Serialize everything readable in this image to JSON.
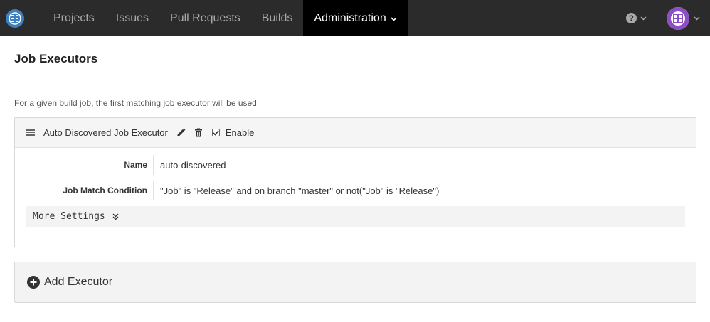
{
  "nav": {
    "items": [
      {
        "label": "Projects"
      },
      {
        "label": "Issues"
      },
      {
        "label": "Pull Requests"
      },
      {
        "label": "Builds"
      },
      {
        "label": "Administration"
      }
    ],
    "active_index": 4
  },
  "page": {
    "title": "Job Executors",
    "hint": "For a given build job, the first matching job executor will be used"
  },
  "executor": {
    "name": "Auto Discovered Job Executor",
    "enable_label": "Enable",
    "enabled": true,
    "props": [
      {
        "label": "Name",
        "value": "auto-discovered"
      },
      {
        "label": "Job Match Condition",
        "value": "\"Job\" is \"Release\" and on branch \"master\" or not(\"Job\" is \"Release\")"
      }
    ],
    "more_settings": "More Settings"
  },
  "add": {
    "label": "Add Executor"
  },
  "colors": {
    "topbar": "#2b2b2b",
    "active_nav": "#000000",
    "avatar_accent": "#8e4fc6"
  }
}
